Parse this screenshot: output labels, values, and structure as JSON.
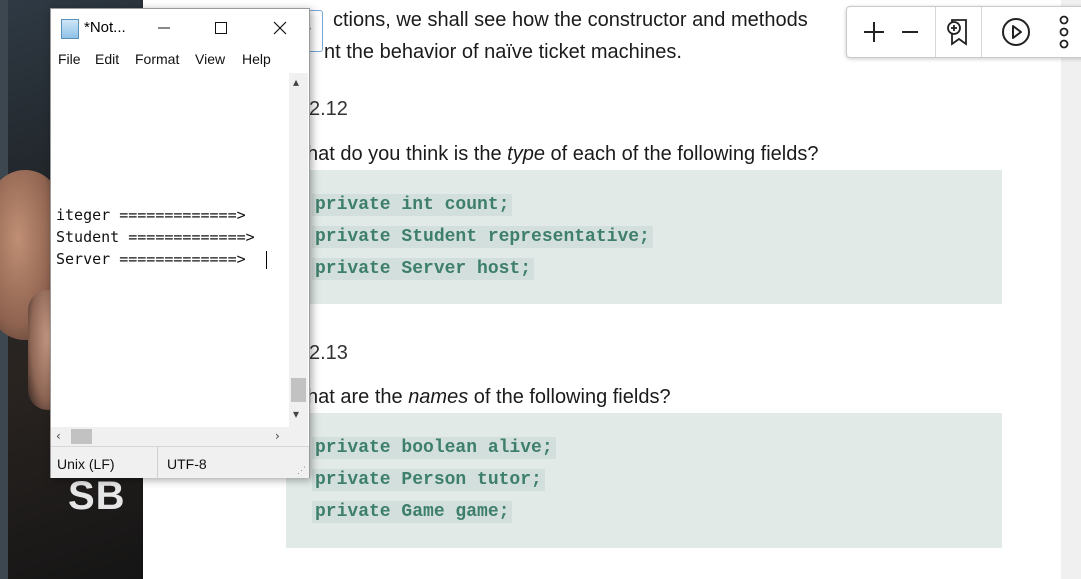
{
  "document": {
    "intro_line1": "ctions, we shall see how the constructor and methods",
    "intro_line2": "nt the behavior of naïve ticket machines.",
    "exercises": [
      {
        "number": "2.12",
        "question_pre": "hat do you think is the ",
        "question_em": "type",
        "question_post": " of each of the following fields?",
        "code": [
          "private int count;",
          "private Student representative;",
          "private Server host;"
        ]
      },
      {
        "number": "2.13",
        "question_pre": "hat are the ",
        "question_em": "names",
        "question_post": " of the following fields?",
        "code": [
          "private boolean alive;",
          "private Person tutor;",
          "private Game game;"
        ]
      }
    ]
  },
  "toolbar": {
    "zoom_in_icon": "plus-icon",
    "zoom_out_icon": "minus-icon",
    "bookmark_icon": "bookmark-add-icon",
    "play_icon": "play-icon",
    "more_icon": "more-vertical-icon"
  },
  "background": {
    "logo_text": "SB"
  },
  "notepad": {
    "title": "*Not...",
    "menus": [
      "File",
      "Edit",
      "Format",
      "View",
      "Help"
    ],
    "lines": [
      "iteger =============>",
      "Student =============>",
      "Server =============>"
    ],
    "status": {
      "line_ending": "Unix (LF)",
      "encoding": "UTF-8"
    }
  },
  "colors": {
    "code_box_bg": "#e2eae8",
    "code_text": "#3d7f6a",
    "code_highlight": "#d3dfdc"
  }
}
